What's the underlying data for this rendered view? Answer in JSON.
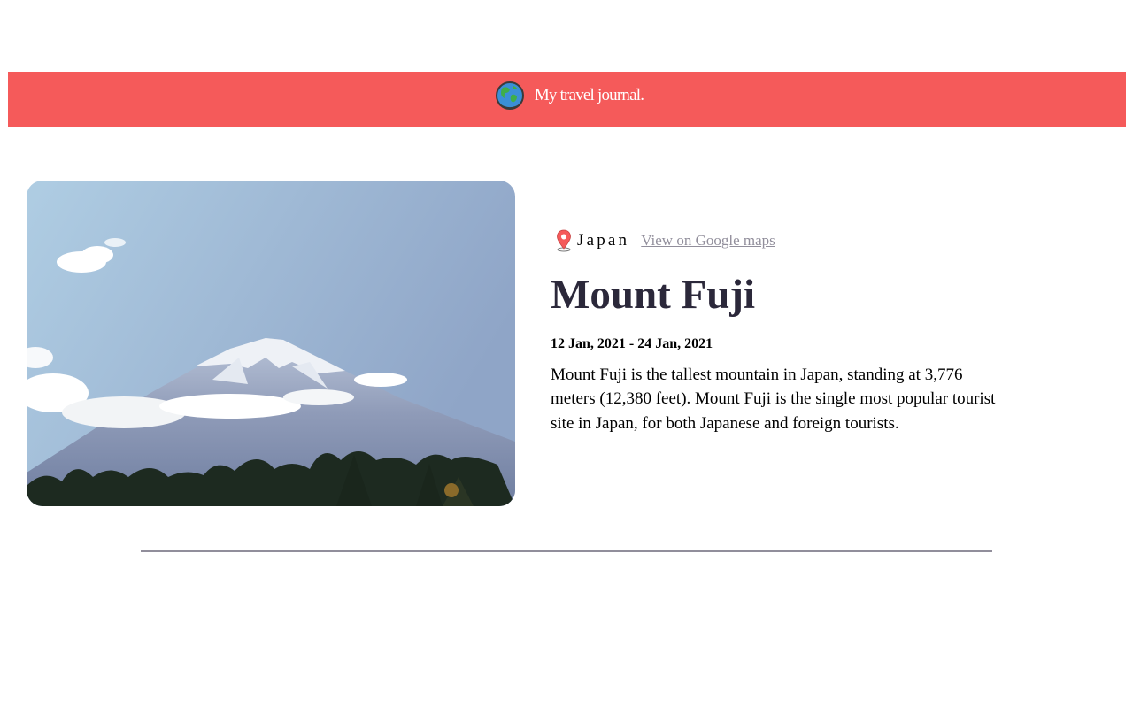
{
  "header": {
    "title": "My travel journal.",
    "bar_color": "#f55a5a",
    "logo_icon": "globe-icon"
  },
  "entry": {
    "location": {
      "icon": "map-pin-icon",
      "country": "Japan",
      "maps_link_label": "View on Google maps"
    },
    "title": "Mount Fuji",
    "dates": "12 Jan, 2021 - 24 Jan, 2021",
    "description": "Mount Fuji is the tallest mountain in Japan, standing at 3,776 meters (12,380 feet). Mount Fuji is the single most popular tourist site in Japan, for both Japanese and foreign tourists."
  },
  "colors": {
    "title": "#2b283a",
    "link": "#918e9b",
    "divider": "#918e9b"
  }
}
